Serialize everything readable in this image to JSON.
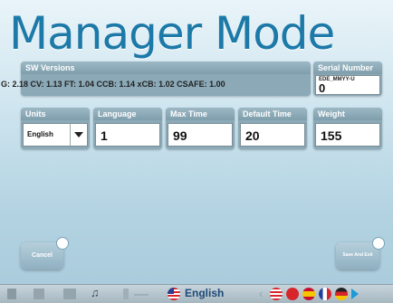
{
  "title": "Manager Mode",
  "sw_versions": {
    "label": "SW Versions",
    "value": "G: 2.18  CV: 1.13  FT: 1.04  CCB: 1.14  xCB: 1.02  CSAFE: 1.00"
  },
  "serial": {
    "label": "Serial Number",
    "small_text": "EDE_MMYY-U",
    "value": "0"
  },
  "fields": {
    "units": {
      "label": "Units",
      "value": "English"
    },
    "language": {
      "label": "Language",
      "value": "1"
    },
    "max_time": {
      "label": "Max Time",
      "value": "99"
    },
    "default_time": {
      "label": "Default Time",
      "value": "20"
    },
    "weight": {
      "label": "Weight",
      "value": "155"
    }
  },
  "buttons": {
    "cancel": "Cancel",
    "save": "Save And Exit"
  },
  "taskbar": {
    "language_label": "English",
    "colors": {
      "bar": "#b3c3cb",
      "accent": "#1c79a8"
    }
  }
}
